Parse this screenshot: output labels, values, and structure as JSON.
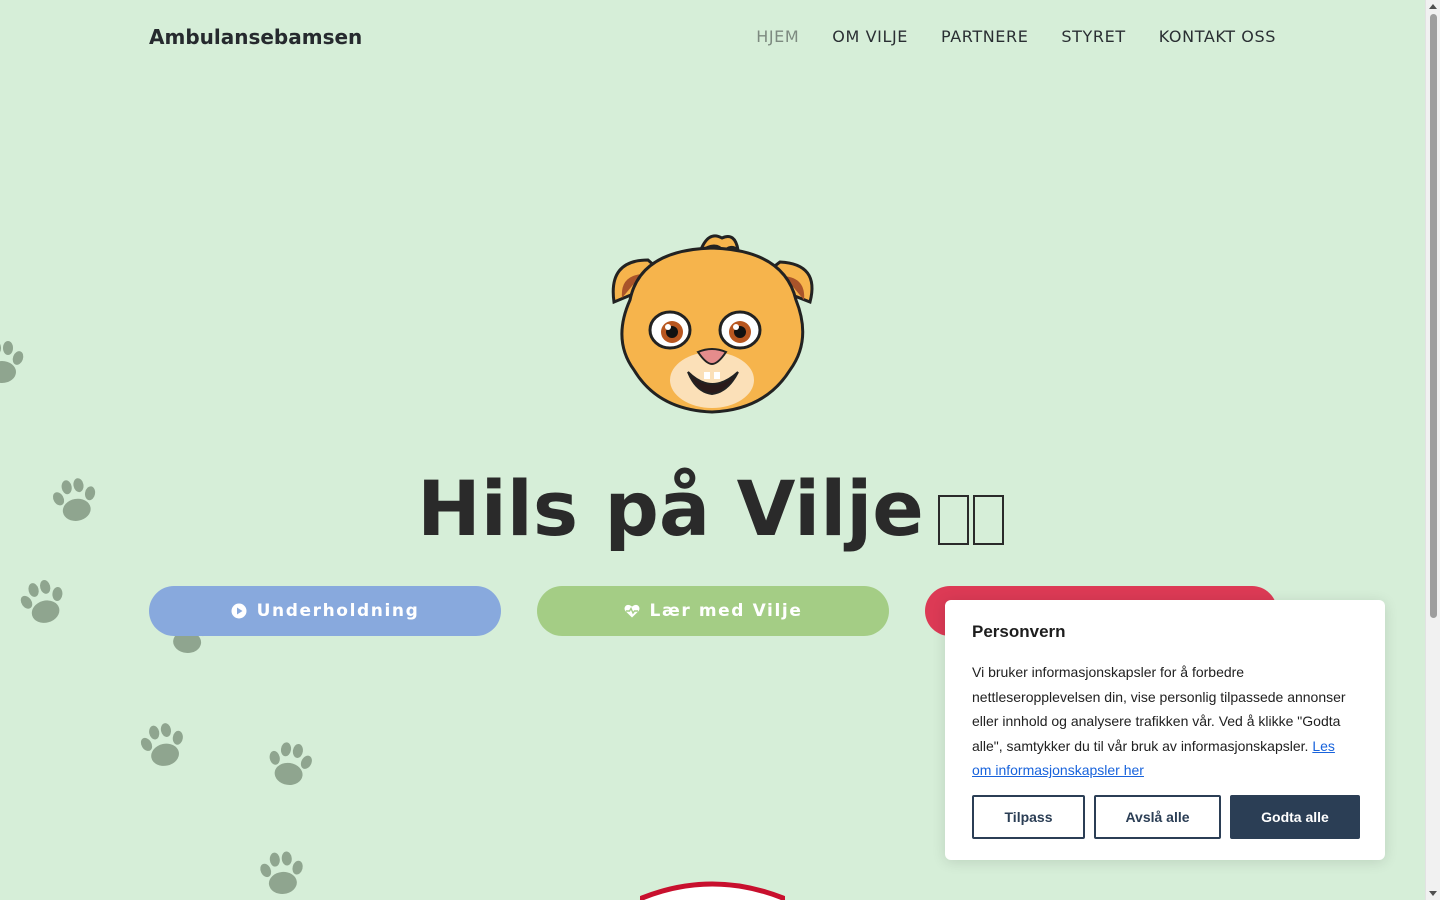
{
  "header": {
    "brand": "Ambulansebamsen",
    "nav": [
      "HJEM",
      "OM VILJE",
      "PARTNERE",
      "STYRET",
      "KONTAKT OSS"
    ],
    "active_nav": "HJEM"
  },
  "hero": {
    "title": "Hils på Vilje",
    "buttons": [
      {
        "label": "Underholdning",
        "icon": "play-circle-icon",
        "color": "#88a9dd"
      },
      {
        "label": "Lær med Vilje",
        "icon": "heart-pulse-icon",
        "color": "#a4cd85"
      },
      {
        "label": "",
        "icon": "",
        "color": "#dc3a55"
      }
    ]
  },
  "cookie": {
    "title": "Personvern",
    "text": "Vi bruker informasjonskapsler for å forbedre nettleseropplevelsen din, vise personlig tilpassede annonser eller innhold og analysere trafikken vår. Ved å klikke \"Godta alle\", samtykker du til vår bruk av informasjonskapsler.",
    "link": "Les om informasjonskapsler her",
    "customize": "Tilpass",
    "reject": "Avslå alle",
    "accept": "Godta alle"
  },
  "colors": {
    "background": "#d6eed8",
    "accent_dark": "#2b3e55",
    "link": "#1863dc"
  }
}
